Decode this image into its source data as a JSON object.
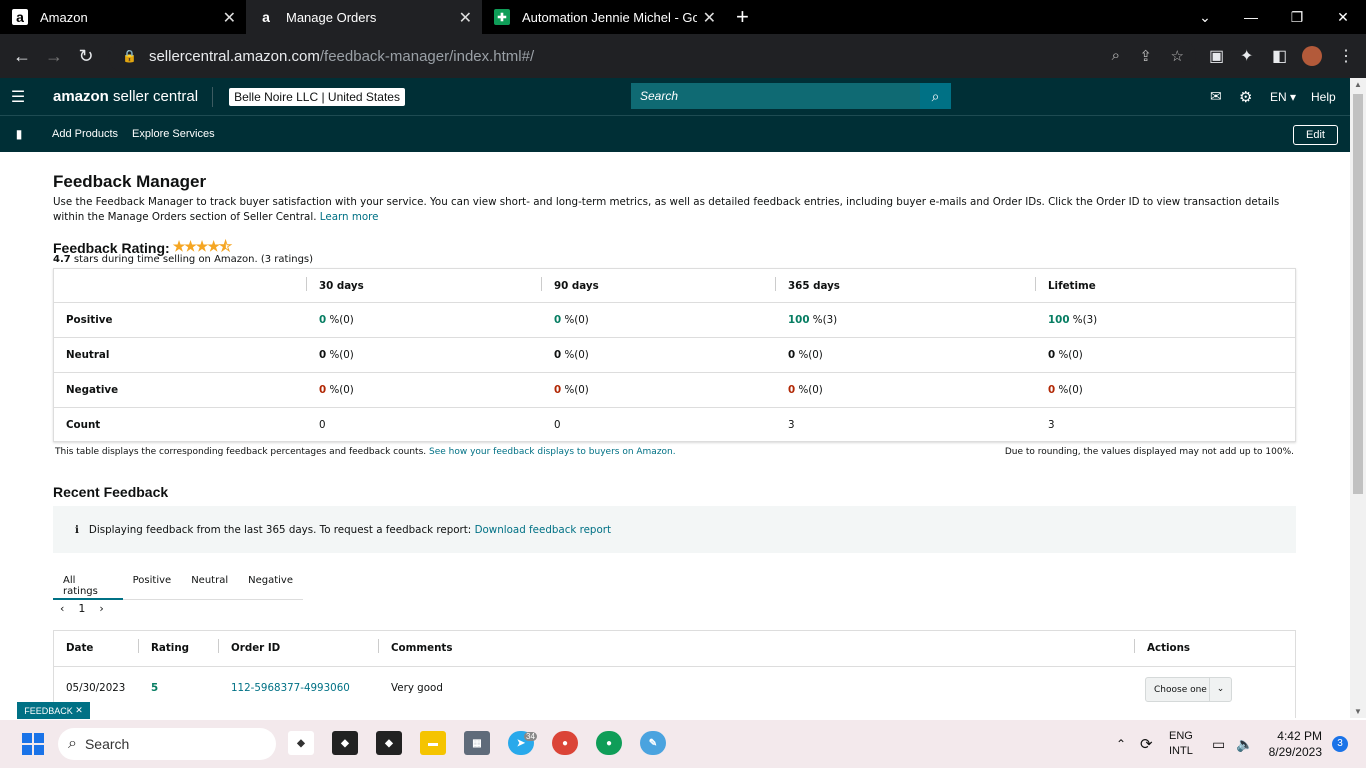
{
  "browser": {
    "tabs": [
      {
        "title": "Amazon",
        "icon": "amazon-icon"
      },
      {
        "title": "Manage Orders",
        "icon": "amazon-icon"
      },
      {
        "title": "Automation Jennie Michel - Goo",
        "icon": "sheets-icon"
      }
    ],
    "url_host": "sellercentral.amazon.com",
    "url_path": "/feedback-manager/index.html#/"
  },
  "header": {
    "logo_brand": "amazon",
    "logo_product": "seller central",
    "store": "Belle Noire LLC | United States",
    "search_placeholder": "Search",
    "language": "EN",
    "help": "Help"
  },
  "nav": {
    "links": [
      "Add Products",
      "Explore Services"
    ],
    "edit": "Edit"
  },
  "page": {
    "title": "Feedback Manager",
    "intro": "Use the Feedback Manager to track buyer satisfaction with your service. You can view short- and long-term metrics, as well as detailed feedback entries, including buyer e-mails and Order IDs. Click the Order ID to view transaction details within the Manage Orders section of Seller Central.",
    "learn_more": "Learn more",
    "rating_label": "Feedback Rating:",
    "rating_stars": 4.5,
    "rating_value": "4.7",
    "rating_text": "stars during time selling on Amazon. (3 ratings)"
  },
  "metrics": {
    "columns": [
      "30 days",
      "90 days",
      "365 days",
      "Lifetime"
    ],
    "rows": [
      {
        "label": "Positive",
        "values": [
          "0",
          "0",
          "100",
          "100"
        ],
        "suffix": [
          "%(0)",
          "%(0)",
          "%(3)",
          "%(3)"
        ],
        "tone": "positive"
      },
      {
        "label": "Neutral",
        "values": [
          "0",
          "0",
          "0",
          "0"
        ],
        "suffix": [
          "%(0)",
          "%(0)",
          "%(0)",
          "%(0)"
        ],
        "tone": "neutral"
      },
      {
        "label": "Negative",
        "values": [
          "0",
          "0",
          "0",
          "0"
        ],
        "suffix": [
          "%(0)",
          "%(0)",
          "%(0)",
          "%(0)"
        ],
        "tone": "negative"
      },
      {
        "label": "Count",
        "values": [
          "0",
          "0",
          "3",
          "3"
        ],
        "suffix": [
          "",
          "",
          "",
          ""
        ],
        "tone": "plain"
      }
    ],
    "note_left": "This table displays the corresponding feedback percentages and feedback counts.",
    "note_left_link": "See how your feedback displays to buyers on Amazon.",
    "note_right": "Due to rounding, the values displayed may not add up to 100%."
  },
  "recent": {
    "title": "Recent Feedback",
    "alert_text": "Displaying feedback from the last 365 days. To request a feedback report:",
    "alert_link": "Download feedback report",
    "tabs": [
      "All ratings",
      "Positive",
      "Neutral",
      "Negative"
    ],
    "page": "1",
    "columns": [
      "Date",
      "Rating",
      "Order ID",
      "Comments",
      "Actions"
    ],
    "rows": [
      {
        "date": "05/30/2023",
        "rating": "5",
        "order_id": "112-5968377-4993060",
        "comment": "Very good",
        "action": "Choose one"
      }
    ]
  },
  "feedback_tab": "FEEDBACK",
  "taskbar": {
    "search": "Search",
    "lang1": "ENG",
    "lang2": "INTL",
    "time": "4:42 PM",
    "date": "8/29/2023",
    "notifications": "3",
    "telegram_badge": "34"
  },
  "colors": {
    "header_bg": "#002f36",
    "link": "#007185",
    "positive": "#067d62",
    "negative": "#b12704"
  }
}
